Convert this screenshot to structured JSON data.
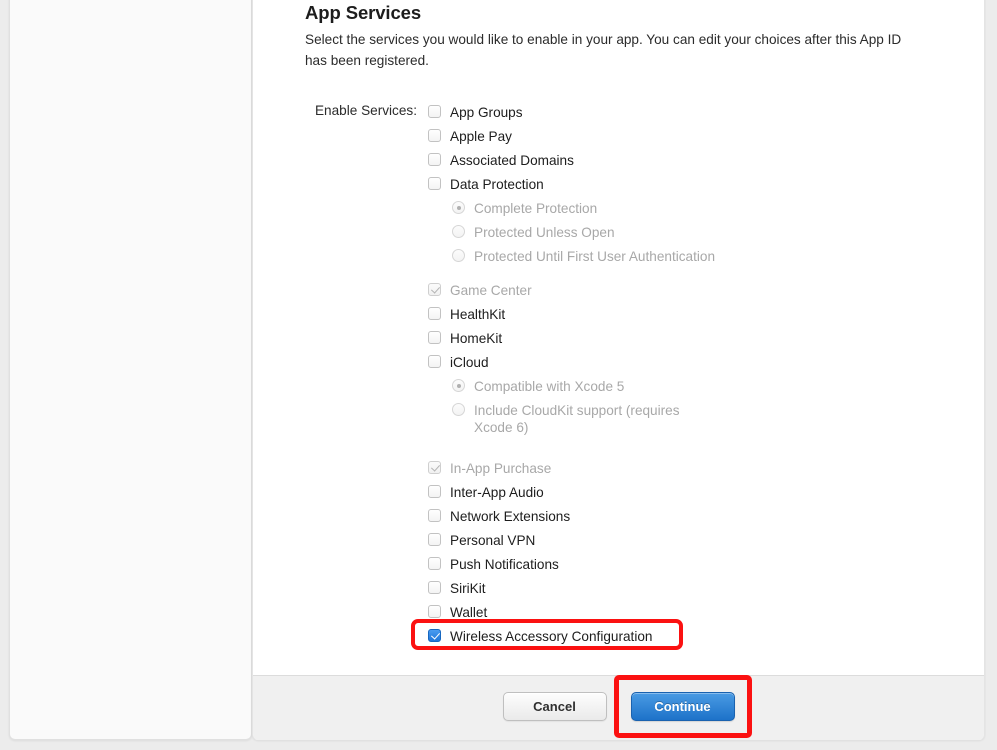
{
  "page": {
    "title": "App Services",
    "description": "Select the services you would like to enable in your app. You can edit your choices after this App ID has been registered.",
    "enable_label": "Enable Services:"
  },
  "colors": {
    "accent_blue": "#2176d2",
    "highlight_red": "#fb1111",
    "panel_bg": "#ffffff",
    "footer_bg": "#f0f0f0",
    "disabled_text": "#a8a8a8"
  },
  "services": [
    {
      "label": "App Groups",
      "checked": false,
      "disabled": false,
      "highlighted": false,
      "group_start": false
    },
    {
      "label": "Apple Pay",
      "checked": false,
      "disabled": false,
      "highlighted": false,
      "group_start": false
    },
    {
      "label": "Associated Domains",
      "checked": false,
      "disabled": false,
      "highlighted": false,
      "group_start": false
    },
    {
      "label": "Data Protection",
      "checked": false,
      "disabled": false,
      "highlighted": false,
      "group_start": false
    },
    {
      "label": "Game Center",
      "checked": true,
      "disabled": true,
      "highlighted": false,
      "group_start": true
    },
    {
      "label": "HealthKit",
      "checked": false,
      "disabled": false,
      "highlighted": false,
      "group_start": false
    },
    {
      "label": "HomeKit",
      "checked": false,
      "disabled": false,
      "highlighted": false,
      "group_start": false
    },
    {
      "label": "iCloud",
      "checked": false,
      "disabled": false,
      "highlighted": false,
      "group_start": false
    },
    {
      "label": "In-App Purchase",
      "checked": true,
      "disabled": true,
      "highlighted": false,
      "group_start": true
    },
    {
      "label": "Inter-App Audio",
      "checked": false,
      "disabled": false,
      "highlighted": false,
      "group_start": false
    },
    {
      "label": "Network Extensions",
      "checked": false,
      "disabled": false,
      "highlighted": false,
      "group_start": false
    },
    {
      "label": "Personal VPN",
      "checked": false,
      "disabled": false,
      "highlighted": false,
      "group_start": false
    },
    {
      "label": "Push Notifications",
      "checked": false,
      "disabled": false,
      "highlighted": false,
      "group_start": false
    },
    {
      "label": "SiriKit",
      "checked": false,
      "disabled": false,
      "highlighted": false,
      "group_start": false
    },
    {
      "label": "Wallet",
      "checked": false,
      "disabled": false,
      "highlighted": false,
      "group_start": false
    },
    {
      "label": "Wireless Accessory Configuration",
      "checked": true,
      "disabled": false,
      "highlighted": true,
      "group_start": false
    }
  ],
  "data_protection_options": [
    {
      "label": "Complete Protection",
      "selected": true,
      "disabled": true
    },
    {
      "label": "Protected Unless Open",
      "selected": false,
      "disabled": true
    },
    {
      "label": "Protected Until First User Authentication",
      "selected": false,
      "disabled": true
    }
  ],
  "icloud_options": [
    {
      "label": "Compatible with Xcode 5",
      "selected": true,
      "disabled": true,
      "two_line": false
    },
    {
      "label": "Include CloudKit support (requires Xcode 6)",
      "selected": false,
      "disabled": true,
      "two_line": true
    }
  ],
  "footer": {
    "cancel_label": "Cancel",
    "continue_label": "Continue"
  }
}
